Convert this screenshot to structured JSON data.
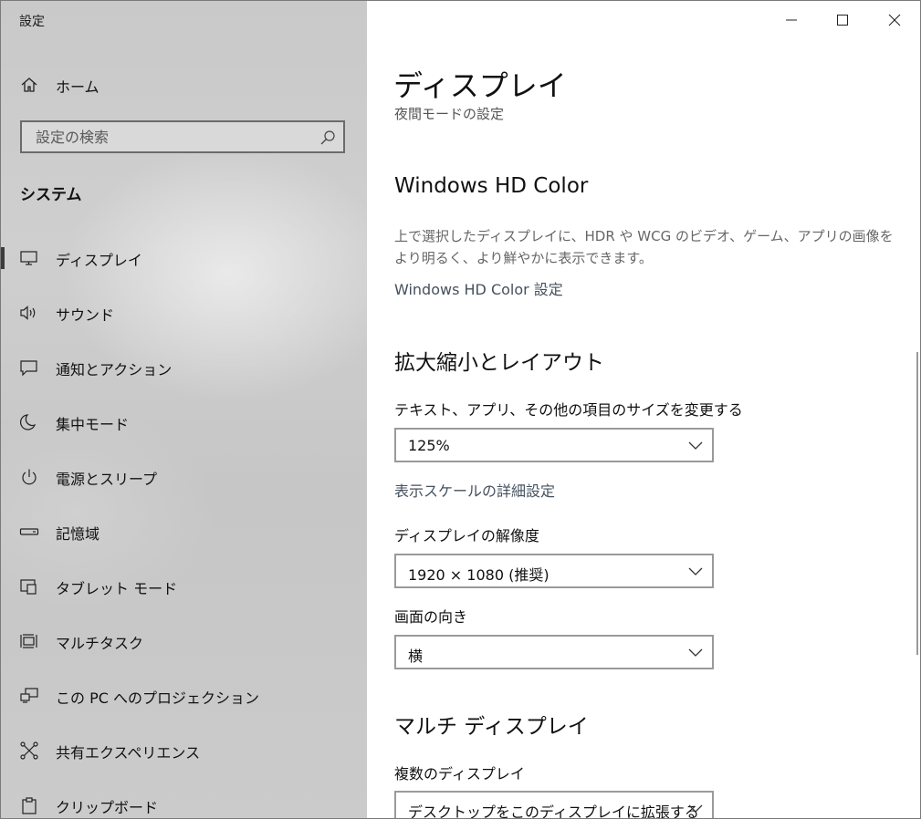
{
  "app": {
    "title": "設定"
  },
  "sidebar": {
    "home_label": "ホーム",
    "search_placeholder": "設定の検索",
    "section": "システム",
    "items": [
      {
        "label": "ディスプレイ",
        "icon": "monitor-icon",
        "active": true
      },
      {
        "label": "サウンド",
        "icon": "speaker-icon"
      },
      {
        "label": "通知とアクション",
        "icon": "notification-icon"
      },
      {
        "label": "集中モード",
        "icon": "moon-icon"
      },
      {
        "label": "電源とスリープ",
        "icon": "power-icon"
      },
      {
        "label": "記憶域",
        "icon": "storage-icon"
      },
      {
        "label": "タブレット モード",
        "icon": "tablet-mode-icon"
      },
      {
        "label": "マルチタスク",
        "icon": "multitask-icon"
      },
      {
        "label": "この PC へのプロジェクション",
        "icon": "projection-icon"
      },
      {
        "label": "共有エクスペリエンス",
        "icon": "shared-experience-icon"
      },
      {
        "label": "クリップボード",
        "icon": "clipboard-icon"
      }
    ]
  },
  "window_controls": {
    "minimize": "minimize-icon",
    "maximize": "maximize-icon",
    "close": "close-icon"
  },
  "main": {
    "title": "ディスプレイ",
    "night_light_link": "夜間モードの設定",
    "hd_color": {
      "heading": "Windows HD Color",
      "description": "上で選択したディスプレイに、HDR や WCG のビデオ、ゲーム、アプリの画像をより明るく、より鮮やかに表示できます。",
      "link": "Windows HD Color 設定"
    },
    "scale_layout": {
      "heading": "拡大縮小とレイアウト",
      "size_label": "テキスト、アプリ、その他の項目のサイズを変更する",
      "size_value": "125%",
      "advanced_link": "表示スケールの詳細設定",
      "resolution_label": "ディスプレイの解像度",
      "resolution_value": "1920 × 1080 (推奨)",
      "orientation_label": "画面の向き",
      "orientation_value": "横"
    },
    "multi_display": {
      "heading": "マルチ ディスプレイ",
      "label": "複数のディスプレイ",
      "value": "デスクトップをこのディスプレイに拡張する"
    }
  }
}
